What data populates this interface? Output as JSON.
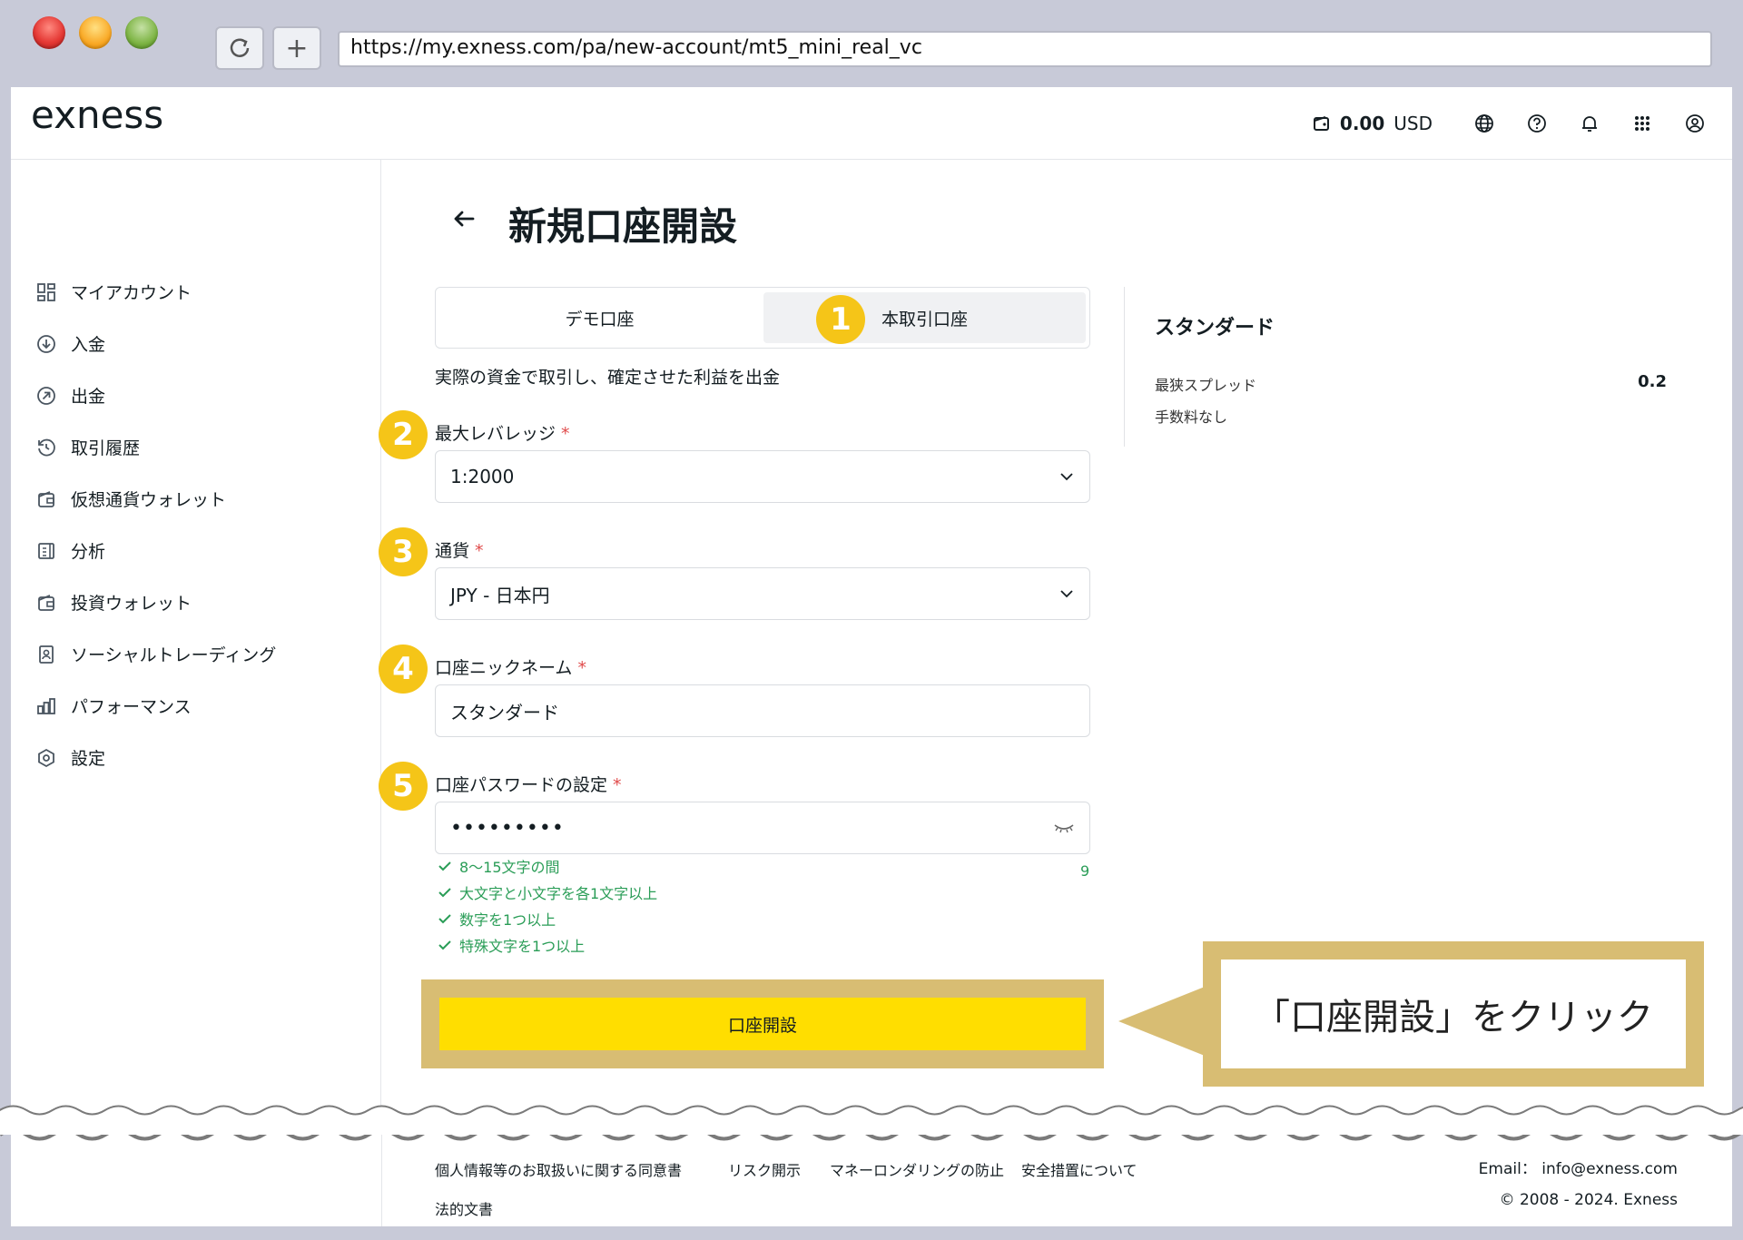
{
  "browser": {
    "url": "https://my.exness.com/pa/new-account/mt5_mini_real_vc"
  },
  "header": {
    "logo": "exness",
    "balance_amount": "0.00",
    "balance_currency": "USD"
  },
  "sidebar": {
    "items": [
      {
        "label": "マイアカウント",
        "icon": "dashboard-icon"
      },
      {
        "label": "入金",
        "icon": "deposit-icon"
      },
      {
        "label": "出金",
        "icon": "withdraw-icon"
      },
      {
        "label": "取引履歴",
        "icon": "history-icon"
      },
      {
        "label": "仮想通貨ウォレット",
        "icon": "wallet-icon"
      },
      {
        "label": "分析",
        "icon": "analytics-icon"
      },
      {
        "label": "投資ウォレット",
        "icon": "wallet-icon"
      },
      {
        "label": "ソーシャルトレーディング",
        "icon": "social-trading-icon"
      },
      {
        "label": "パフォーマンス",
        "icon": "performance-icon"
      },
      {
        "label": "設定",
        "icon": "settings-icon"
      }
    ]
  },
  "main": {
    "title": "新規口座開設",
    "tabs": {
      "demo": "デモ口座",
      "real": "本取引口座"
    },
    "description": "実際の資金で取引し、確定させた利益を出金",
    "fields": {
      "leverage": {
        "label": "最大レバレッジ",
        "value": "1:2000"
      },
      "currency": {
        "label": "通貨",
        "value": "JPY - 日本円"
      },
      "nickname": {
        "label": "口座ニックネーム",
        "value": "スタンダード"
      },
      "password": {
        "label": "口座パスワードの設定",
        "value": "•••••••••"
      }
    },
    "required_mark": "*",
    "password_rules": [
      "8〜15文字の間",
      "大文字と小文字を各1文字以上",
      "数字を1つ以上",
      "特殊文字を1つ以上"
    ],
    "password_length": "9",
    "submit_label": "口座開設",
    "badges": [
      "1",
      "2",
      "3",
      "4",
      "5"
    ]
  },
  "summary": {
    "title": "スタンダード",
    "spread_label": "最狭スプレッド",
    "spread_value": "0.2",
    "commission_label": "手数料なし"
  },
  "callout": {
    "text": "「口座開設」をクリック"
  },
  "footer": {
    "links": [
      "個人情報等のお取扱いに関する同意書",
      "リスク開示",
      "マネーロンダリングの防止",
      "安全措置について"
    ],
    "legal": "法的文書",
    "email": "Email： info@exness.com",
    "copyright": "© 2008 - 2024. Exness"
  },
  "colors": {
    "accent": "#ffde00",
    "badge": "#f5c518",
    "highlight_frame": "#d8bd73",
    "success": "#2a9d57",
    "required": "#e04b4b"
  }
}
